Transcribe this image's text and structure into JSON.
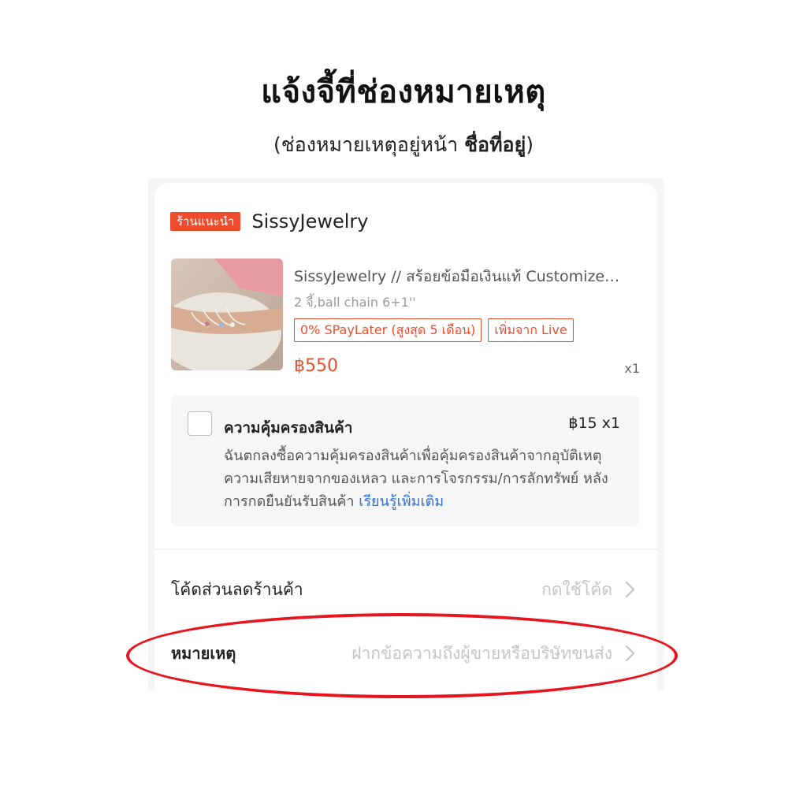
{
  "header": {
    "title": "แจ้งจี้ที่ช่องหมายเหตุ",
    "subtitle_prefix": "(ช่องหมายเหตุอยู่หน้า ",
    "subtitle_bold": "ชื่อที่อยู่",
    "subtitle_suffix": ")"
  },
  "shop": {
    "badge": "ร้านแนะนำ",
    "name": "SissyJewelry"
  },
  "product": {
    "title": "SissyJewelry // สร้อยข้อมือเงินแท้ Customize…",
    "variant": "2 จี้,ball chain 6+1''",
    "tags": [
      "0% SPayLater (สูงสุด 5 เดือน)",
      "เพิ่มจาก Live"
    ],
    "price": "฿550",
    "qty": "x1"
  },
  "protection": {
    "title": "ความคุ้มครองสินค้า",
    "price": "฿15  x1",
    "description": "ฉันตกลงซื้อความคุ้มครองสินค้าเพื่อคุ้มครองสินค้าจากอุบัติเหตุ ความเสียหายจากของเหลว และการโจรกรรม/การลักทรัพย์ หลังการกดยืนยันรับสินค้า ",
    "link": "เรียนรู้เพิ่มเติม"
  },
  "voucher": {
    "label": "โค้ดส่วนลดร้านค้า",
    "action": "กดใช้โค้ด"
  },
  "note": {
    "label": "หมายเหตุ",
    "placeholder": "ฝากข้อความถึงผู้ขายหรือบริษัทขนส่ง"
  },
  "colors": {
    "accent": "#ee4d2d",
    "link": "#2f6fd6",
    "highlight": "#e8141e"
  },
  "icons": {
    "chevron": "chevron-right-icon"
  }
}
